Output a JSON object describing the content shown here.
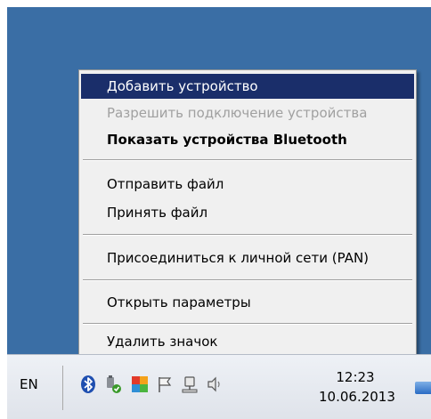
{
  "context_menu": {
    "items": [
      {
        "label": "Добавить устройство"
      },
      {
        "label": "Разрешить подключение устройства"
      },
      {
        "label": "Показать устройства Bluetooth"
      },
      {
        "label": "Отправить файл"
      },
      {
        "label": "Принять файл"
      },
      {
        "label": "Присоединиться к личной сети (PAN)"
      },
      {
        "label": "Открыть параметры"
      },
      {
        "label": "Удалить значок"
      }
    ]
  },
  "taskbar": {
    "language": "EN",
    "clock_time": "12:23",
    "clock_date": "10.06.2013",
    "tray_icons": [
      "bluetooth-icon",
      "safely-remove-hardware-icon",
      "antivirus-icon",
      "action-center-flag-icon",
      "network-icon",
      "volume-icon"
    ]
  },
  "colors": {
    "desktop": "#3a6ea5",
    "menu_highlight": "#1a2e6a",
    "menu_background": "#f0f0f0",
    "disabled_text": "#a0a0a0"
  }
}
